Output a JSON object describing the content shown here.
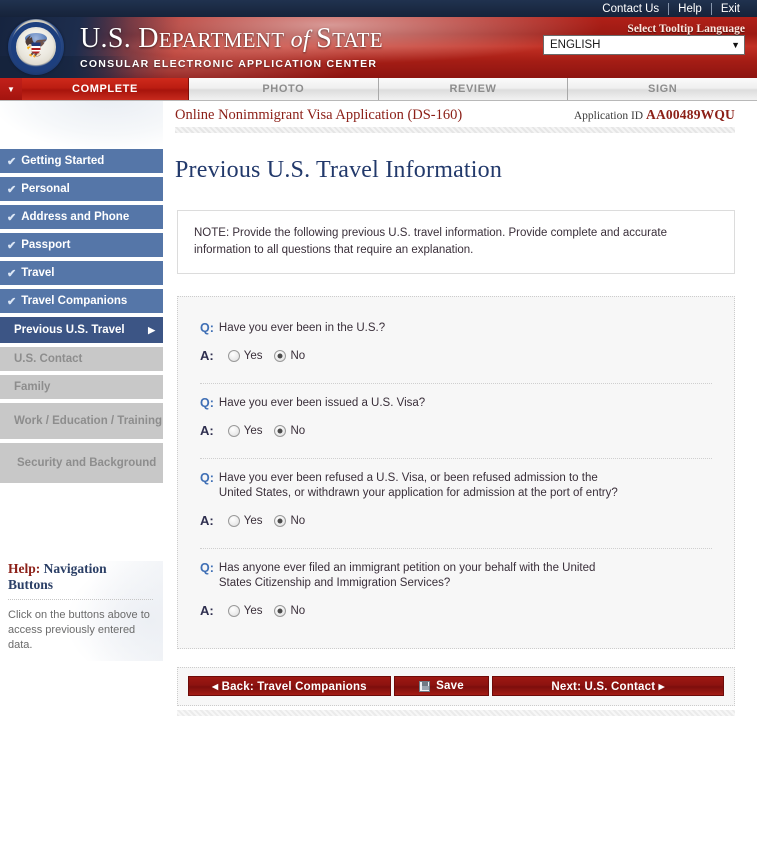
{
  "topbar": {
    "links": [
      "Contact Us",
      "Help",
      "Exit"
    ]
  },
  "banner": {
    "title_part1": "U.S. D",
    "title_part2": "EPARTMENT",
    "title_of": " of ",
    "title_part3": "S",
    "title_part4": "TATE",
    "subtitle": "CONSULAR ELECTRONIC APPLICATION CENTER",
    "language_label": "Select Tooltip Language",
    "language_value": "ENGLISH",
    "seal_alt": "Great Seal of the United States"
  },
  "tabs": [
    {
      "label": "COMPLETE",
      "active": true
    },
    {
      "label": "PHOTO",
      "active": false
    },
    {
      "label": "REVIEW",
      "active": false
    },
    {
      "label": "SIGN",
      "active": false
    }
  ],
  "app_header": {
    "title": "Online Nonimmigrant Visa Application (DS-160)",
    "application_id_label": "Application ID ",
    "application_id_value": "AA00489WQU"
  },
  "page": {
    "title": "Previous U.S. Travel Information",
    "note": "NOTE: Provide the following previous U.S. travel information. Provide complete and accurate information to all questions that require an explanation."
  },
  "sidebar": {
    "items": [
      {
        "label": "Getting Started",
        "state": "complete"
      },
      {
        "label": "Personal",
        "state": "complete"
      },
      {
        "label": "Address and Phone",
        "state": "complete"
      },
      {
        "label": "Passport",
        "state": "complete"
      },
      {
        "label": "Travel",
        "state": "complete"
      },
      {
        "label": "Travel Companions",
        "state": "complete"
      },
      {
        "label": "Previous U.S. Travel",
        "state": "current"
      },
      {
        "label": "U.S. Contact",
        "state": "disabled"
      },
      {
        "label": "Family",
        "state": "disabled"
      },
      {
        "label": "Work / Education / Training",
        "state": "disabled"
      },
      {
        "label": "Security and Background",
        "state": "disabled"
      }
    ],
    "check_glyph": "✔",
    "arrow_glyph": "▶",
    "help": {
      "title_highlight": "Help:",
      "title_rest": " Navigation Buttons",
      "body": "Click on the buttons above to access previously entered data."
    }
  },
  "questions": [
    {
      "q_mark": "Q:",
      "a_mark": "A:",
      "text": "Have you ever been in the U.S.?",
      "options": [
        "Yes",
        "No"
      ],
      "selected": "No"
    },
    {
      "q_mark": "Q:",
      "a_mark": "A:",
      "text": "Have you ever been issued a U.S. Visa?",
      "options": [
        "Yes",
        "No"
      ],
      "selected": "No"
    },
    {
      "q_mark": "Q:",
      "a_mark": "A:",
      "text": "Have you ever been refused a U.S. Visa, or been refused admission to the United States, or withdrawn your application for admission at the port of entry?",
      "options": [
        "Yes",
        "No"
      ],
      "selected": "No"
    },
    {
      "q_mark": "Q:",
      "a_mark": "A:",
      "text": "Has anyone ever filed an immigrant petition on your behalf with the United States Citizenship and Immigration Services?",
      "options": [
        "Yes",
        "No"
      ],
      "selected": "No"
    }
  ],
  "buttons": {
    "back": "◂ Back: Travel Companions",
    "save": "Save",
    "next": "Next: U.S. Contact ▸"
  },
  "colors": {
    "brand_red": "#8c1310",
    "brand_navy": "#22396b",
    "nav_blue": "#5576a8",
    "nav_current": "#3c5585",
    "nav_disabled": "#c8c8c8",
    "title_maroon": "#8c2018"
  }
}
